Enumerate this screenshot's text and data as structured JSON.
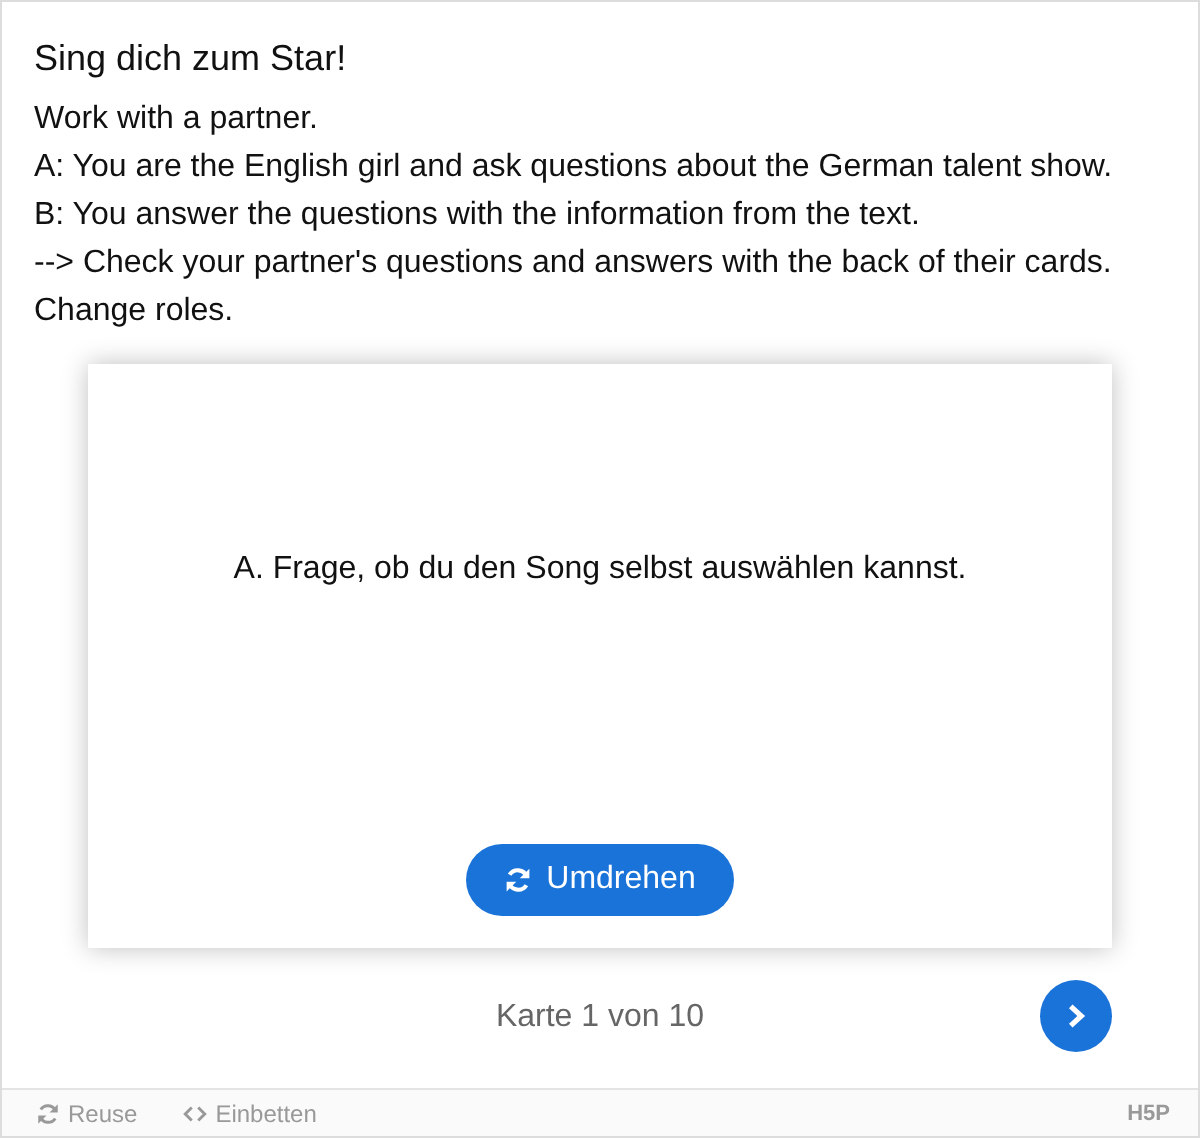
{
  "title": "Sing dich zum Star!",
  "instructions": [
    "Work with a partner.",
    "A: You are the English girl and ask questions about the German talent show.",
    "B: You answer the questions with the information from the text.",
    "--> Check your partner's questions and answers with the back of their cards.",
    "Change roles."
  ],
  "card": {
    "text": "A. Frage, ob du den Song selbst auswählen kannst.",
    "flip_button": "Umdrehen"
  },
  "progress": "Karte 1 von 10",
  "footer": {
    "actions": [
      {
        "kind": "reuse",
        "label": "Reuse"
      },
      {
        "kind": "embed",
        "label": "Einbetten"
      }
    ],
    "logo": "H5P"
  }
}
